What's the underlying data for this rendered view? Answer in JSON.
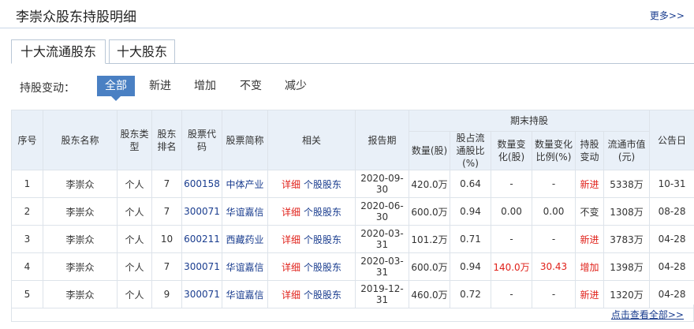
{
  "header": {
    "title": "李崇众股东持股明细",
    "more": "更多>>"
  },
  "tabs": [
    {
      "label": "十大流通股东",
      "active": true
    },
    {
      "label": "十大股东",
      "active": false
    }
  ],
  "filter": {
    "label": "持股变动：",
    "options": [
      {
        "label": "全部",
        "active": true
      },
      {
        "label": "新进",
        "active": false
      },
      {
        "label": "增加",
        "active": false
      },
      {
        "label": "不变",
        "active": false
      },
      {
        "label": "减少",
        "active": false
      }
    ]
  },
  "table": {
    "group_header": "期末持股",
    "headers": [
      "序号",
      "股东名称",
      "股东类型",
      "股东排名",
      "股票代码",
      "股票简称",
      "相关",
      "报告期",
      "数量(股)",
      "股占流通股比(%)",
      "数量变化(股)",
      "数量变化比例(%)",
      "持股变动",
      "流通市值(元)",
      "公告日"
    ],
    "rows": [
      {
        "no": "1",
        "name": "李崇众",
        "type": "个人",
        "rank": "7",
        "code": "600158",
        "abbr": "中体产业",
        "detail": "详细",
        "related": "个股股东",
        "period": "2020-09-30",
        "qty": "420.0万",
        "ratio": "0.64",
        "chg": "-",
        "chg_ratio": "-",
        "change": "新进",
        "mv": "5338万",
        "date": "10-31"
      },
      {
        "no": "2",
        "name": "李崇众",
        "type": "个人",
        "rank": "7",
        "code": "300071",
        "abbr": "华谊嘉信",
        "detail": "详细",
        "related": "个股股东",
        "period": "2020-06-30",
        "qty": "600.0万",
        "ratio": "0.94",
        "chg": "0.00",
        "chg_ratio": "0.00",
        "change": "不变",
        "mv": "1308万",
        "date": "08-28"
      },
      {
        "no": "3",
        "name": "李崇众",
        "type": "个人",
        "rank": "10",
        "code": "600211",
        "abbr": "西藏药业",
        "detail": "详细",
        "related": "个股股东",
        "period": "2020-03-31",
        "qty": "101.2万",
        "ratio": "0.71",
        "chg": "-",
        "chg_ratio": "-",
        "change": "新进",
        "mv": "3783万",
        "date": "04-28"
      },
      {
        "no": "4",
        "name": "李崇众",
        "type": "个人",
        "rank": "7",
        "code": "300071",
        "abbr": "华谊嘉信",
        "detail": "详细",
        "related": "个股股东",
        "period": "2020-03-31",
        "qty": "600.0万",
        "ratio": "0.94",
        "chg": "140.0万",
        "chg_ratio": "30.43",
        "change": "增加",
        "mv": "1398万",
        "date": "04-28"
      },
      {
        "no": "5",
        "name": "李崇众",
        "type": "个人",
        "rank": "9",
        "code": "300071",
        "abbr": "华谊嘉信",
        "detail": "详细",
        "related": "个股股东",
        "period": "2019-12-31",
        "qty": "460.0万",
        "ratio": "0.72",
        "chg": "-",
        "chg_ratio": "-",
        "change": "新进",
        "mv": "1320万",
        "date": "04-28"
      }
    ]
  },
  "footer": {
    "all_link": "点击查看全部>>"
  },
  "colors": {
    "accent": "#4a80c3",
    "header_bg": "#e9f0f8",
    "red": "#e0211a",
    "link": "#1a3d8f"
  }
}
